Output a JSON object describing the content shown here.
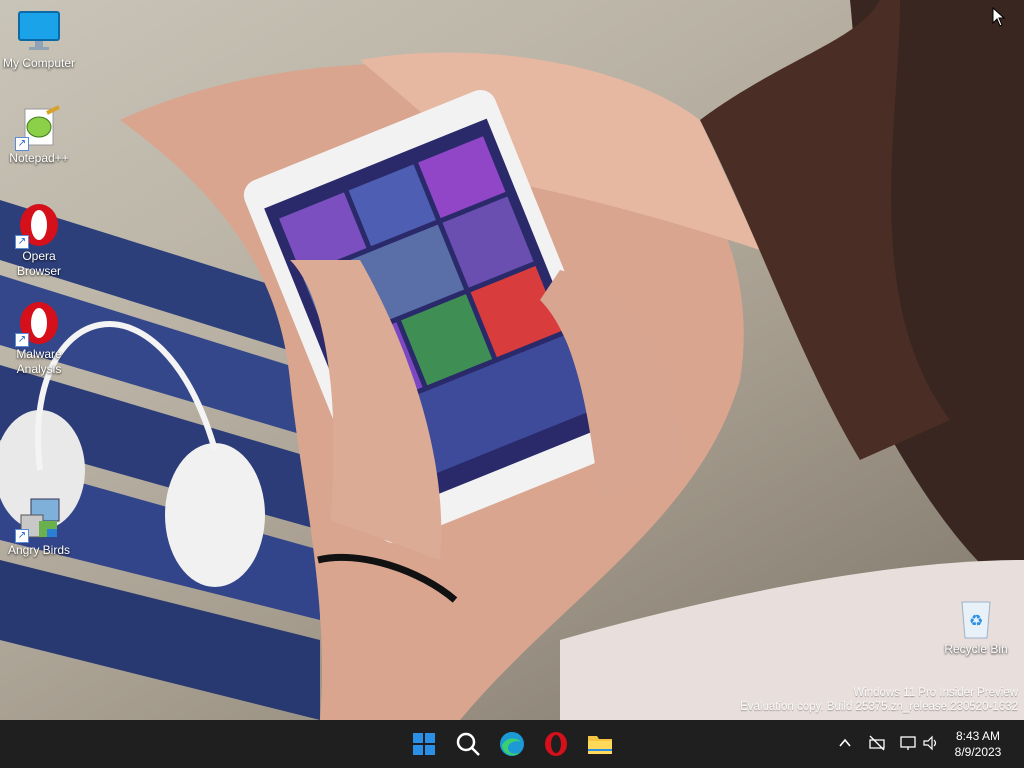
{
  "desktop": {
    "icons": [
      {
        "label": "My Computer",
        "icon": "monitor-icon"
      },
      {
        "label": "Notepad++",
        "icon": "notepadpp-icon"
      },
      {
        "label": "Opera\nBrowser",
        "icon": "opera-icon"
      },
      {
        "label": "Malware\nAnalysis",
        "icon": "opera-icon"
      },
      {
        "label": "Angry Birds",
        "icon": "installer-icon"
      },
      {
        "label": "Recycle Bin",
        "icon": "recycle-bin-icon"
      }
    ],
    "watermark": {
      "line1": "Windows 11 Pro Insider Preview",
      "line2": "Evaluation copy. Build 25375.zn_release.230520-1632"
    }
  },
  "taskbar": {
    "apps": [
      "start-icon",
      "search-icon",
      "edge-icon",
      "opera-icon",
      "file-explorer-icon"
    ],
    "tray": {
      "icons": [
        "chevron-up-icon",
        "network-offline-icon",
        "display-icon",
        "speaker-icon"
      ],
      "time": "8:43 AM",
      "date": "8/9/2023"
    }
  },
  "colors": {
    "taskbar_bg": "#1f1f1f",
    "opera_red": "#d6101a",
    "windows_blue": "#2b8fe6"
  }
}
